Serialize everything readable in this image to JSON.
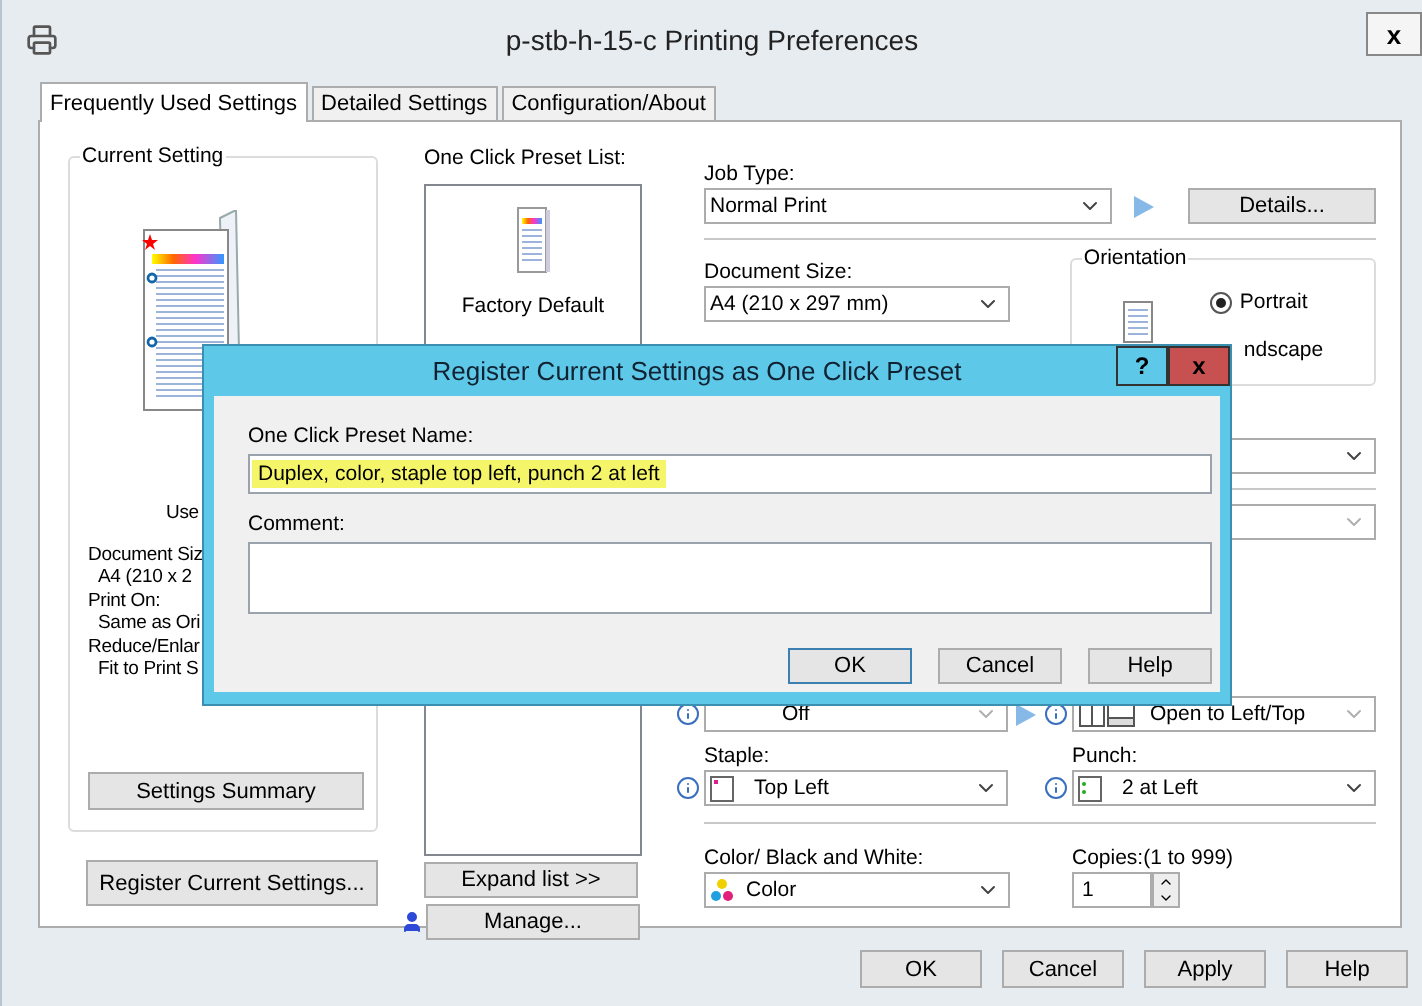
{
  "window": {
    "title": "p-stb-h-15-c Printing Preferences",
    "close": "x"
  },
  "tabs": [
    {
      "label": "Frequently Used Settings",
      "selected": true
    },
    {
      "label": "Detailed Settings",
      "selected": false
    },
    {
      "label": "Configuration/About",
      "selected": false
    }
  ],
  "current_setting": {
    "title": "Current Setting",
    "lines": [
      {
        "kind": "heading",
        "text": "Use"
      },
      {
        "kind": "label",
        "text": "Document Siz"
      },
      {
        "kind": "value",
        "text": "A4 (210 x 2"
      },
      {
        "kind": "label",
        "text": "Print On:"
      },
      {
        "kind": "value",
        "text": "Same as Ori"
      },
      {
        "kind": "label",
        "text": "Reduce/Enlar"
      },
      {
        "kind": "value",
        "text": "Fit to Print S"
      }
    ],
    "summary_button": "Settings Summary"
  },
  "register_button": "Register Current Settings...",
  "preset_list": {
    "label": "One Click Preset List:",
    "items": [
      {
        "name": "Factory Default",
        "selected": false
      }
    ],
    "expand_button": "Expand list >>",
    "manage_button": "Manage..."
  },
  "job_type": {
    "label": "Job Type:",
    "value": "Normal Print",
    "details_button": "Details..."
  },
  "document_size": {
    "label": "Document Size:",
    "value": "A4 (210 x 297 mm)"
  },
  "orientation": {
    "title": "Orientation",
    "options": [
      {
        "label": "Portrait",
        "selected": true
      }
    ],
    "partial_option": "ndscape"
  },
  "finishing": {
    "value": "Off"
  },
  "binding": {
    "value": "Open to Left/Top"
  },
  "staple": {
    "label": "Staple:",
    "value": "Top Left"
  },
  "punch": {
    "label": "Punch:",
    "value": "2 at Left"
  },
  "color_mode": {
    "label": "Color/ Black and White:",
    "value": "Color"
  },
  "copies": {
    "label": "Copies:(1 to 999)",
    "value": "1"
  },
  "buttons": [
    {
      "label": "OK"
    },
    {
      "label": "Cancel"
    },
    {
      "label": "Apply"
    },
    {
      "label": "Help"
    }
  ],
  "dialog": {
    "title": "Register Current Settings as One Click Preset",
    "help": "?",
    "close": "x",
    "name_label": "One Click Preset Name:",
    "name_value": "Duplex, color, staple top left, punch 2 at left",
    "comment_label": "Comment:",
    "buttons": [
      {
        "label": "OK",
        "default": true
      },
      {
        "label": "Cancel",
        "default": false
      },
      {
        "label": "Help",
        "default": false
      }
    ]
  }
}
